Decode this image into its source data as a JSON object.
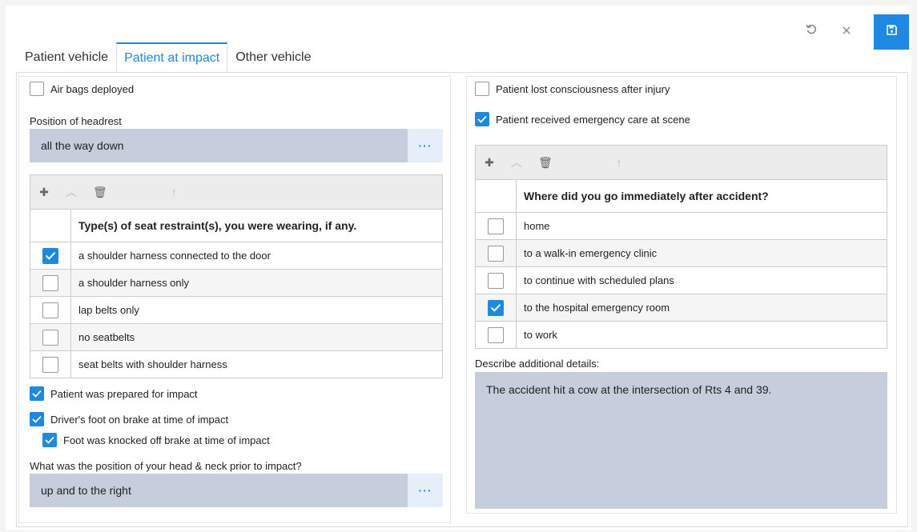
{
  "toolbar": {
    "undo_icon": "undo-icon",
    "close_icon": "close-icon",
    "save_icon": "save-icon"
  },
  "tabs": [
    {
      "label": "Patient vehicle",
      "active": false
    },
    {
      "label": "Patient at impact",
      "active": true
    },
    {
      "label": "Other vehicle",
      "active": false
    }
  ],
  "left": {
    "airbags": {
      "label": "Air bags deployed",
      "checked": false
    },
    "headrest": {
      "label": "Position of headrest",
      "value": "all the way down"
    },
    "restraint_grid": {
      "header": "Type(s) of seat restraint(s), you were wearing, if any.",
      "rows": [
        {
          "text": "a shoulder harness connected to the door",
          "checked": true
        },
        {
          "text": "a shoulder harness only",
          "checked": false
        },
        {
          "text": "lap belts only",
          "checked": false
        },
        {
          "text": "no seatbelts",
          "checked": false
        },
        {
          "text": "seat belts with shoulder harness",
          "checked": false
        }
      ]
    },
    "prepared": {
      "label": "Patient was prepared for impact",
      "checked": true
    },
    "brake": {
      "label": "Driver's foot on brake at time of impact",
      "checked": true
    },
    "knocked": {
      "label": "Foot was knocked off brake at time of impact",
      "checked": true
    },
    "head_neck": {
      "label": "What was the position of your head & neck prior to impact?",
      "value": "up and to the right"
    }
  },
  "right": {
    "consciousness": {
      "label": "Patient lost consciousness after injury",
      "checked": false
    },
    "emergency": {
      "label": "Patient received emergency care at scene",
      "checked": true
    },
    "where_grid": {
      "header": "Where did you go immediately after accident?",
      "rows": [
        {
          "text": "home",
          "checked": false
        },
        {
          "text": "to a walk-in emergency clinic",
          "checked": false
        },
        {
          "text": "to continue with scheduled plans",
          "checked": false
        },
        {
          "text": "to the hospital emergency room",
          "checked": true
        },
        {
          "text": "to work",
          "checked": false
        }
      ]
    },
    "details": {
      "label": "Describe additional details:",
      "value": "The accident hit a cow at the intersection of Rts 4 and 39."
    }
  },
  "colors": {
    "accent": "#1e88e5",
    "field_bg": "#c6cddd"
  }
}
